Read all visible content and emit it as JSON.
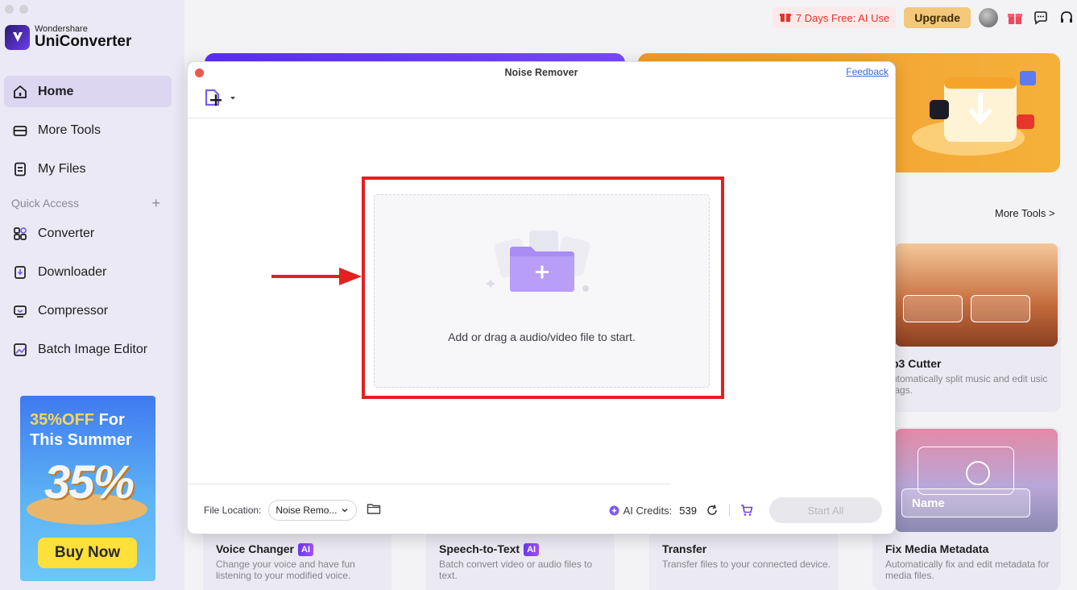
{
  "app": {
    "brand_top": "Wondershare",
    "brand_name": "UniConverter"
  },
  "sidebar": {
    "items": [
      {
        "label": "Home",
        "icon": "home-icon",
        "active": true
      },
      {
        "label": "More Tools",
        "icon": "toolbox-icon"
      },
      {
        "label": "My Files",
        "icon": "file-icon"
      }
    ],
    "quick_access_label": "Quick Access",
    "quick_items": [
      {
        "label": "Converter",
        "icon": "converter-icon"
      },
      {
        "label": "Downloader",
        "icon": "downloader-icon"
      },
      {
        "label": "Compressor",
        "icon": "compressor-icon"
      },
      {
        "label": "Batch Image Editor",
        "icon": "image-editor-icon"
      }
    ],
    "promo": {
      "line1_a": "35%OFF",
      "line1_b": " For",
      "line2": "This Summer",
      "big": "35%",
      "button": "Buy Now"
    }
  },
  "topbar": {
    "free_trial": "7 Days Free: AI Use",
    "upgrade": "Upgrade"
  },
  "main": {
    "more_tools_link": "More Tools >",
    "cards": [
      {
        "title": "p3 Cutter",
        "desc": "utomatically split music and edit usic tags."
      },
      {
        "title": "Voice Changer",
        "ai": "AI",
        "desc": "Change your voice and have fun listening to your modified voice."
      },
      {
        "title": "Speech-to-Text",
        "ai": "AI",
        "desc": "Batch convert video or audio files to text."
      },
      {
        "title": "Transfer",
        "desc": "Transfer files to your connected device."
      },
      {
        "title": "Fix Media Metadata",
        "desc": "Automatically fix and edit metadata for media files."
      }
    ],
    "metadata_card_label": "Name"
  },
  "modal": {
    "title": "Noise Remover",
    "feedback": "Feedback",
    "drop_text": "Add or drag a audio/video file to start.",
    "file_location_label": "File Location:",
    "file_location_value": "Noise Remo...",
    "ai_credits_label": "AI Credits:",
    "ai_credits_value": "539",
    "start_all": "Start All"
  },
  "colors": {
    "accent": "#7b5cf0",
    "annotation_red": "#e5201f",
    "sidebar_bg": "#ece9f6"
  }
}
